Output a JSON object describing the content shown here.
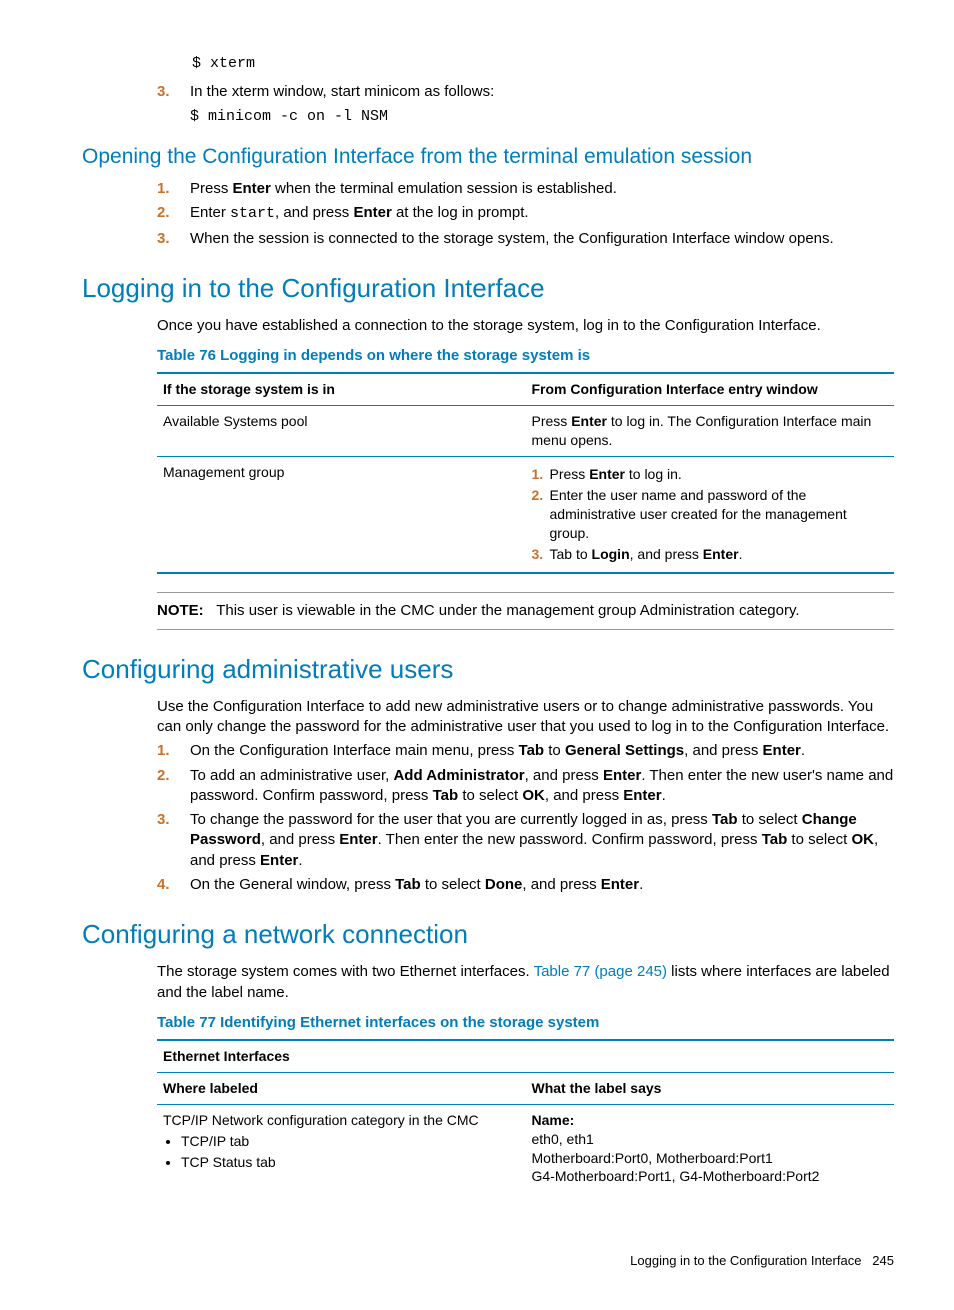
{
  "topcode": "$ xterm",
  "step3_text_a": "In the xterm window, start minicom as follows:",
  "step3_code": "$ minicom -c on -l NSM",
  "h3_open": "Opening the Configuration Interface from the terminal emulation session",
  "open_steps": {
    "s1a": "Press ",
    "s1b": "Enter",
    "s1c": " when the terminal emulation session is established.",
    "s2a": "Enter ",
    "s2code": "start",
    "s2b": ", and press ",
    "s2c": "Enter",
    "s2d": " at the log in prompt.",
    "s3": "When the session is connected to the storage system, the Configuration Interface window opens."
  },
  "h2_login": "Logging in to the Configuration Interface",
  "login_intro": "Once you have established a connection to the storage system, log in to the Configuration Interface.",
  "t76_caption": "Table 76 Logging in depends on where the storage system is",
  "t76_h1": "If the storage system is in",
  "t76_h2": "From Configuration Interface entry window",
  "t76_r1c1": "Available Systems pool",
  "t76_r1c2a": "Press ",
  "t76_r1c2b": "Enter",
  "t76_r1c2c": " to log in. The Configuration Interface main menu opens.",
  "t76_r2c1": "Management group",
  "t76_r2_s1a": "Press ",
  "t76_r2_s1b": "Enter",
  "t76_r2_s1c": " to log in.",
  "t76_r2_s2": "Enter the user name and password of the administrative user created for the management group.",
  "t76_r2_s3a": "Tab to ",
  "t76_r2_s3b": "Login",
  "t76_r2_s3c": ", and press ",
  "t76_r2_s3d": "Enter",
  "t76_r2_s3e": ".",
  "note_label": "NOTE:",
  "note_text": "This user is viewable in the CMC under the management group Administration category.",
  "h2_admin": "Configuring administrative users",
  "admin_intro": "Use the Configuration Interface to add new administrative users or to change administrative passwords. You can only change the password for the administrative user that you used to log in to the Configuration Interface.",
  "admin_s1a": "On the Configuration Interface main menu, press ",
  "admin_s1b": "Tab",
  "admin_s1c": " to ",
  "admin_s1d": "General Settings",
  "admin_s1e": ", and press ",
  "admin_s1f": "Enter",
  "admin_s1g": ".",
  "admin_s2a": "To add an administrative user, ",
  "admin_s2b": "Add Administrator",
  "admin_s2c": ", and press ",
  "admin_s2d": "Enter",
  "admin_s2e": ". Then enter the new user's name and password. Confirm password, press ",
  "admin_s2f": "Tab",
  "admin_s2g": " to select ",
  "admin_s2h": "OK",
  "admin_s2i": ", and press ",
  "admin_s2j": "Enter",
  "admin_s2k": ".",
  "admin_s3a": "To change the password for the user that you are currently logged in as, press ",
  "admin_s3b": "Tab",
  "admin_s3c": " to select ",
  "admin_s3d": "Change Password",
  "admin_s3e": ", and press ",
  "admin_s3f": "Enter",
  "admin_s3g": ". Then enter the new password. Confirm password, press ",
  "admin_s3h": "Tab",
  "admin_s3i": " to select ",
  "admin_s3j": "OK",
  "admin_s3k": ", and press ",
  "admin_s3l": "Enter",
  "admin_s3m": ".",
  "admin_s4a": "On the General window, press ",
  "admin_s4b": "Tab",
  "admin_s4c": " to select ",
  "admin_s4d": "Done",
  "admin_s4e": ", and press ",
  "admin_s4f": "Enter",
  "admin_s4g": ".",
  "h2_net": "Configuring a network connection",
  "net_intro_a": "The storage system comes with two Ethernet interfaces. ",
  "net_intro_link": "Table 77 (page 245)",
  "net_intro_b": " lists where interfaces are labeled and the label name.",
  "t77_caption": "Table 77 Identifying Ethernet interfaces on the storage system",
  "t77_group": "Ethernet Interfaces",
  "t77_h1": "Where labeled",
  "t77_h2": "What the label says",
  "t77_r1c1_line": "TCP/IP Network configuration category in the CMC",
  "t77_r1c1_b1": "TCP/IP tab",
  "t77_r1c1_b2": "TCP Status tab",
  "t77_r1c2_name": "Name:",
  "t77_r1c2_l1": "eth0, eth1",
  "t77_r1c2_l2": "Motherboard:Port0, Motherboard:Port1",
  "t77_r1c2_l3": "G4-Motherboard:Port1, G4-Motherboard:Port2",
  "footer_text": "Logging in to the Configuration Interface",
  "footer_page": "245",
  "n1": "1.",
  "n2": "2.",
  "n3": "3.",
  "n4": "4."
}
